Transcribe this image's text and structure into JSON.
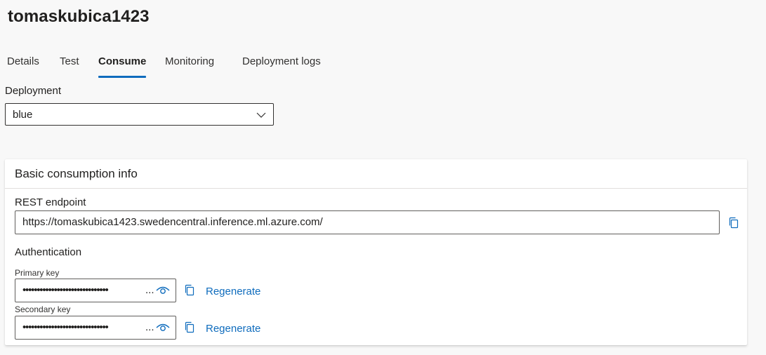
{
  "page": {
    "title": "tomaskubica1423"
  },
  "tabs": [
    {
      "label": "Details"
    },
    {
      "label": "Test"
    },
    {
      "label": "Consume",
      "active": true
    },
    {
      "label": "Monitoring"
    },
    {
      "label": "Deployment logs"
    }
  ],
  "deployment": {
    "label": "Deployment",
    "selected": "blue"
  },
  "consumption": {
    "title": "Basic consumption info",
    "rest_endpoint_label": "REST endpoint",
    "rest_endpoint_value": "https://tomaskubica1423.swedencentral.inference.ml.azure.com/",
    "authentication_label": "Authentication",
    "primary_key_label": "Primary key",
    "primary_key_masked": "••••••••••••••••••••••••••••••",
    "secondary_key_label": "Secondary key",
    "secondary_key_masked": "••••••••••••••••••••••••••••••",
    "key_overflow": "...",
    "regenerate_label": "Regenerate"
  },
  "colors": {
    "accent": "#0f6cbd",
    "text": "#201f1e",
    "background": "#f8f8f8"
  },
  "icons": {
    "dropdown": "chevron-down-icon",
    "copy": "copy-icon",
    "reveal": "eye-icon"
  }
}
